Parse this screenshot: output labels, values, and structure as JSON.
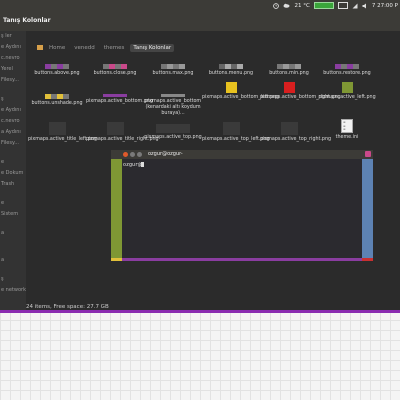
{
  "panel": {
    "temperature": "21 °C",
    "time": "7 27:00 P",
    "colors": {
      "battery": "#3aa53a"
    }
  },
  "window": {
    "title": "Tanış Kolonlar"
  },
  "sidebar": {
    "items": [
      "ş ler",
      "e Aydını",
      "c.nevro",
      "Yerel",
      "Filesy...",
      "",
      "ş",
      "e Aydını",
      "c.nevro",
      "a Aydını",
      "Filesy...",
      "",
      "e",
      "e Dokum",
      "Trash",
      "",
      "e",
      "Sistem",
      "",
      "a",
      "",
      "",
      "",
      "",
      "a",
      "",
      "ş",
      "e network"
    ]
  },
  "breadcrumb": [
    "Home",
    "venedd",
    "themes",
    "Tanış Kolonlar"
  ],
  "files": [
    {
      "name": "buttons.above.png",
      "thumb": "strip"
    },
    {
      "name": "buttons.close.png",
      "thumb": "strip"
    },
    {
      "name": "buttons.max.png",
      "thumb": "strip"
    },
    {
      "name": "buttons.menu.png",
      "thumb": "strip"
    },
    {
      "name": "buttons.min.png",
      "thumb": "strip"
    },
    {
      "name": "buttons.restore.png",
      "thumb": "strip"
    },
    {
      "name": "buttons.unshade.png",
      "thumb": "strip"
    },
    {
      "name": "pixmaps.active_bottom.png",
      "thumb": "purple"
    },
    {
      "name": "pixmaps.active_bottom (kenardaki altı koydum buraya)...",
      "thumb": "gray"
    },
    {
      "name": "pixmaps.active_bottom_left.png",
      "thumb": "yellow"
    },
    {
      "name": "pixmaps.active_bottom_right.png",
      "thumb": "red"
    },
    {
      "name": "pixmaps.active_left.png",
      "thumb": "olive"
    },
    {
      "name": "pixmaps.active_title_left.png",
      "thumb": "dark"
    },
    {
      "name": "pixmaps.active_title_right.png",
      "thumb": "dark"
    },
    {
      "name": "pixmaps.active_top.png",
      "thumb": "widedark"
    },
    {
      "name": "pixmaps.active_top_left.png",
      "thumb": "dark"
    },
    {
      "name": "pixmaps.active_top_right.png",
      "thumb": "dark"
    },
    {
      "name": "theme.ini",
      "thumb": "ini"
    }
  ],
  "status": "24 items, Free space: 27.7 GB",
  "terminal": {
    "title": "ozgur@ozgur-",
    "prompt": "ozgur@"
  }
}
